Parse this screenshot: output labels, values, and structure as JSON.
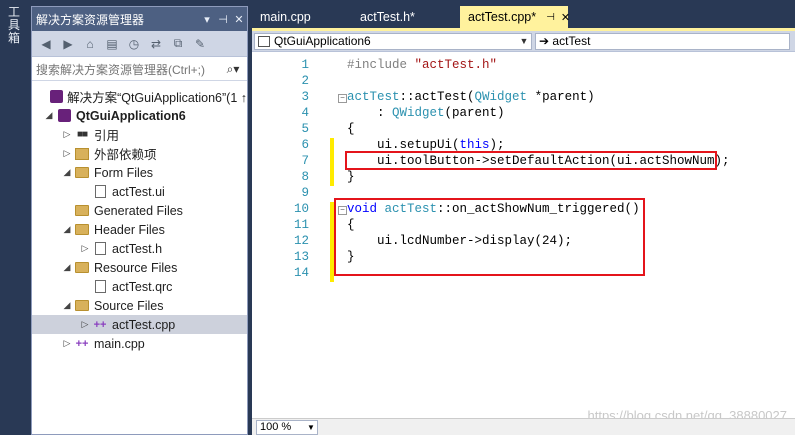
{
  "toolbox": {
    "label": "工具箱"
  },
  "solution_explorer": {
    "title": "解决方案资源管理器",
    "pin": "▾ ✚",
    "close": "✕",
    "search_placeholder": "搜索解决方案资源管理器(Ctrl+;)",
    "search_icon": "⌕▾",
    "tree": [
      {
        "label": "解决方案“QtGuiApplication6”(1 ↑",
        "icon": "vsproj",
        "exp": "",
        "indent": 0,
        "bold": false
      },
      {
        "label": "QtGuiApplication6",
        "icon": "vsproj",
        "exp": "◢",
        "indent": 0,
        "bold": true
      },
      {
        "label": "引用",
        "icon": "ref",
        "exp": "▷",
        "indent": 1,
        "bold": false
      },
      {
        "label": "外部依赖项",
        "icon": "ext",
        "exp": "▷",
        "indent": 1,
        "bold": false
      },
      {
        "label": "Form Files",
        "icon": "folder",
        "exp": "◢",
        "indent": 1,
        "bold": false
      },
      {
        "label": "actTest.ui",
        "icon": "file",
        "exp": "",
        "indent": 2,
        "bold": false
      },
      {
        "label": "Generated Files",
        "icon": "folder",
        "exp": "",
        "indent": 1,
        "bold": false
      },
      {
        "label": "Header Files",
        "icon": "folder",
        "exp": "◢",
        "indent": 1,
        "bold": false
      },
      {
        "label": "actTest.h",
        "icon": "file",
        "exp": "▷",
        "indent": 2,
        "bold": false
      },
      {
        "label": "Resource Files",
        "icon": "folder",
        "exp": "◢",
        "indent": 1,
        "bold": false
      },
      {
        "label": "actTest.qrc",
        "icon": "file",
        "exp": "",
        "indent": 2,
        "bold": false
      },
      {
        "label": "Source Files",
        "icon": "folder",
        "exp": "◢",
        "indent": 1,
        "bold": false
      },
      {
        "label": "actTest.cpp",
        "icon": "cpp",
        "exp": "▷",
        "indent": 2,
        "bold": false,
        "selected": true
      },
      {
        "label": "main.cpp",
        "icon": "cpp",
        "exp": "▷",
        "indent": 1,
        "bold": false
      }
    ]
  },
  "editor": {
    "tabs": [
      {
        "label": "main.cpp",
        "active": false
      },
      {
        "label": "actTest.h*",
        "active": false
      },
      {
        "label": "actTest.cpp*",
        "active": true
      }
    ],
    "tab_pin": "⊣",
    "tab_close": "✕",
    "scope_combo": "QtGuiApplication6",
    "member_combo": "➔ actTest",
    "zoom": "100 %",
    "watermark": "https://blog.csdn.net/qq_38880027",
    "lines": [
      {
        "n": "1",
        "parts": [
          [
            "pp",
            "#include "
          ],
          [
            "str",
            "\"actTest.h\""
          ]
        ]
      },
      {
        "n": "2",
        "parts": []
      },
      {
        "n": "3",
        "parts": [
          [
            "ty",
            "actTest"
          ],
          [
            "",
            "::"
          ],
          [
            "",
            "actTest("
          ],
          [
            "ty",
            "QWidget"
          ],
          [
            "",
            " *parent)"
          ]
        ]
      },
      {
        "n": "4",
        "parts": [
          [
            "",
            "    : "
          ],
          [
            "ty",
            "QWidget"
          ],
          [
            "",
            "(parent)"
          ]
        ]
      },
      {
        "n": "5",
        "parts": [
          [
            "",
            "{"
          ]
        ]
      },
      {
        "n": "6",
        "parts": [
          [
            "",
            "    ui.setupUi("
          ],
          [
            "kw",
            "this"
          ],
          [
            "",
            ");"
          ]
        ]
      },
      {
        "n": "7",
        "parts": [
          [
            "",
            "    ui.toolButton->setDefaultAction(ui.actShowNum);"
          ]
        ]
      },
      {
        "n": "8",
        "parts": [
          [
            "",
            "}"
          ]
        ]
      },
      {
        "n": "9",
        "parts": []
      },
      {
        "n": "10",
        "parts": [
          [
            "kw",
            "void "
          ],
          [
            "ty",
            "actTest"
          ],
          [
            "",
            "::on_actShowNum_triggered()"
          ]
        ]
      },
      {
        "n": "11",
        "parts": [
          [
            "",
            "{"
          ]
        ]
      },
      {
        "n": "12",
        "parts": [
          [
            "",
            "    ui.lcdNumber->display(24);"
          ]
        ]
      },
      {
        "n": "13",
        "parts": [
          [
            "",
            "}"
          ]
        ]
      },
      {
        "n": "14",
        "parts": []
      }
    ]
  },
  "colors": {
    "accent_tab": "#fff29d",
    "highlight_box": "#e4141b",
    "chrome": "#293955"
  }
}
